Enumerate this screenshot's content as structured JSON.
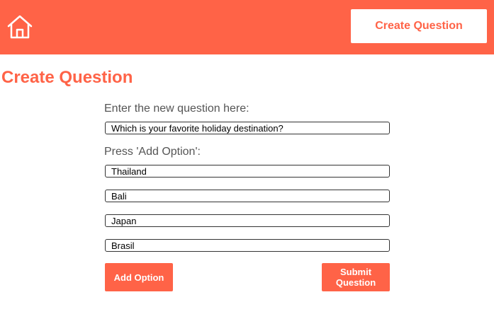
{
  "header": {
    "home_icon": "home-icon",
    "create_button_label": "Create Question"
  },
  "page": {
    "title": "Create Question"
  },
  "form": {
    "question_label": "Enter the new question here:",
    "question_value": "Which is your favorite holiday destination?",
    "options_label": "Press 'Add Option':",
    "options": [
      "Thailand",
      "Bali",
      "Japan",
      "Brasil"
    ],
    "add_option_label": "Add Option",
    "submit_label": "Submit Question"
  },
  "colors": {
    "accent": "#FF6347",
    "label_text": "#555555"
  }
}
